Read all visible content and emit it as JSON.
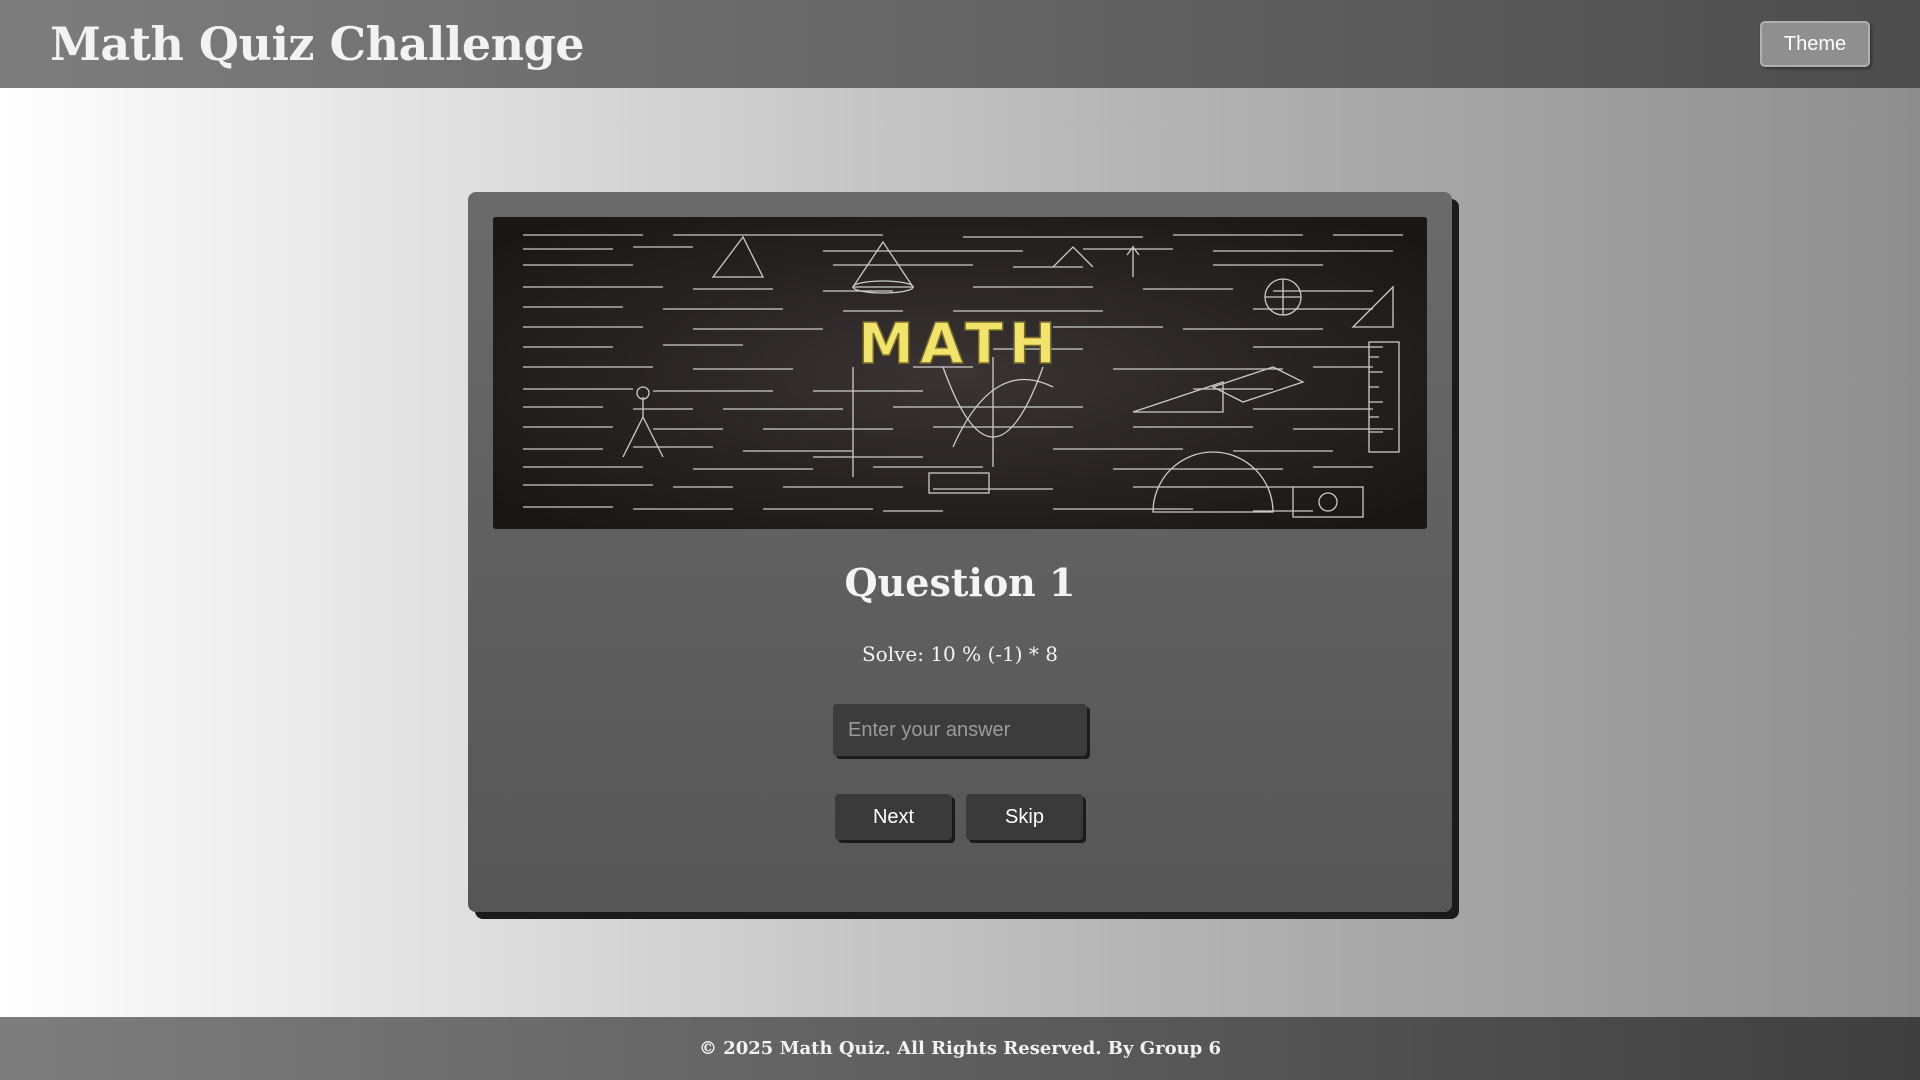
{
  "header": {
    "title": "Math Quiz Challenge",
    "theme_label": "Theme"
  },
  "banner": {
    "word": "MATH",
    "word_color": "#f2e36a"
  },
  "quiz": {
    "question_title": "Question 1",
    "question_text": "Solve: 10 % (-1) * 8",
    "answer_placeholder": "Enter your answer",
    "answer_value": "",
    "next_label": "Next",
    "skip_label": "Skip"
  },
  "footer": {
    "text": "© 2025 Math Quiz. All Rights Reserved. By Group 6"
  }
}
